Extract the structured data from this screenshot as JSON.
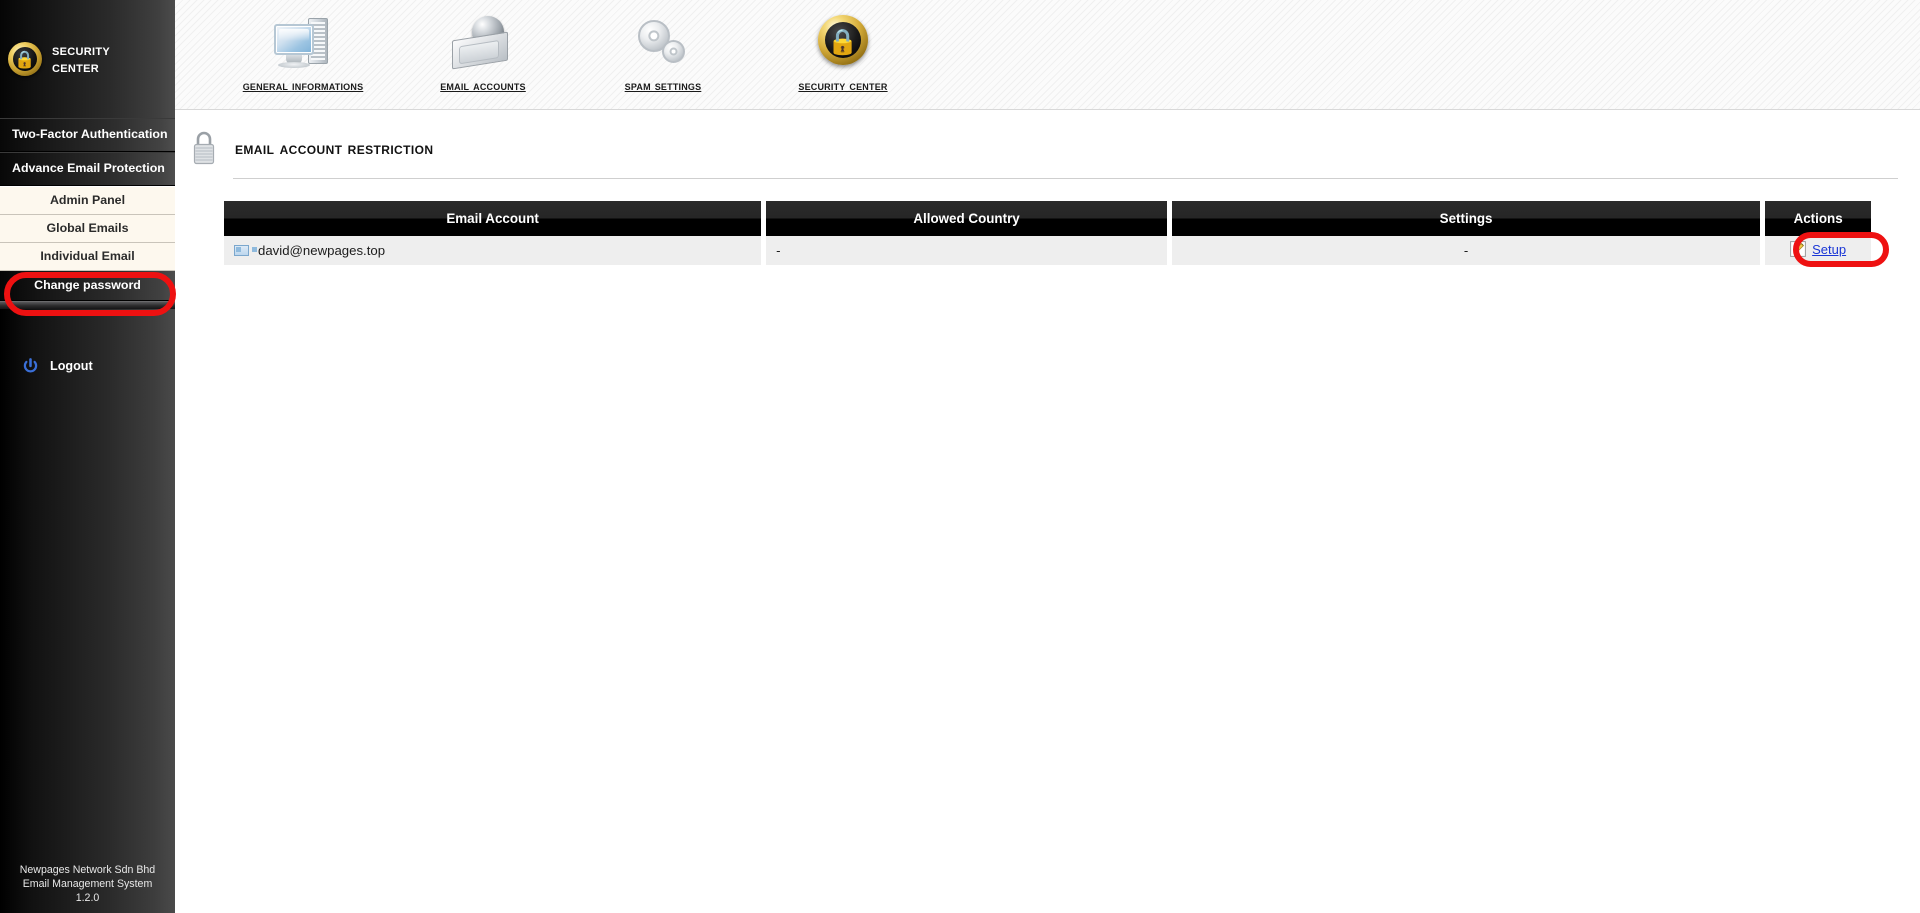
{
  "brand": {
    "line1": "Security",
    "line2": "Center",
    "icon": "gold-lock-badge-icon"
  },
  "sidebar": {
    "groups": [
      {
        "label": "Two-Factor Authentication",
        "type": "group"
      },
      {
        "label": "Advance Email Protection",
        "type": "group"
      }
    ],
    "subitems": [
      {
        "label": "Admin Panel",
        "selected": false
      },
      {
        "label": "Global Emails",
        "selected": false
      },
      {
        "label": "Individual Email",
        "selected": true
      }
    ],
    "plain": [
      {
        "label": "Change password"
      }
    ],
    "logout": {
      "label": "Logout",
      "icon": "power-icon"
    }
  },
  "footer": {
    "line1": "Newpages Network Sdn Bhd",
    "line2": "Email Management System",
    "line3": "1.2.0"
  },
  "topnav": {
    "tabs": [
      {
        "label": "General Informations",
        "icon": "computer-monitor-icon",
        "active": false
      },
      {
        "label": "Email Accounts",
        "icon": "envelope-sphere-icon",
        "active": false
      },
      {
        "label": "Spam Settings",
        "icon": "gears-icon",
        "active": false
      },
      {
        "label": "Security Center",
        "icon": "gold-lock-badge-icon",
        "active": true
      }
    ]
  },
  "page": {
    "title": "Email Account Restriction",
    "icon": "padlock-icon"
  },
  "table": {
    "headers": {
      "email": "Email Account",
      "country": "Allowed Country",
      "settings": "Settings",
      "actions": "Actions"
    },
    "rows": [
      {
        "email": "david@newpages.top",
        "email_icon": "mail-envelope-icon",
        "country": "-",
        "settings": "-",
        "action_label": "Setup",
        "action_icon": "pencil-edit-icon"
      }
    ]
  },
  "highlights": {
    "accent_color": "#ee1111",
    "items": [
      {
        "target": "sidebar-item-individual-email"
      },
      {
        "target": "setup-link"
      }
    ]
  }
}
